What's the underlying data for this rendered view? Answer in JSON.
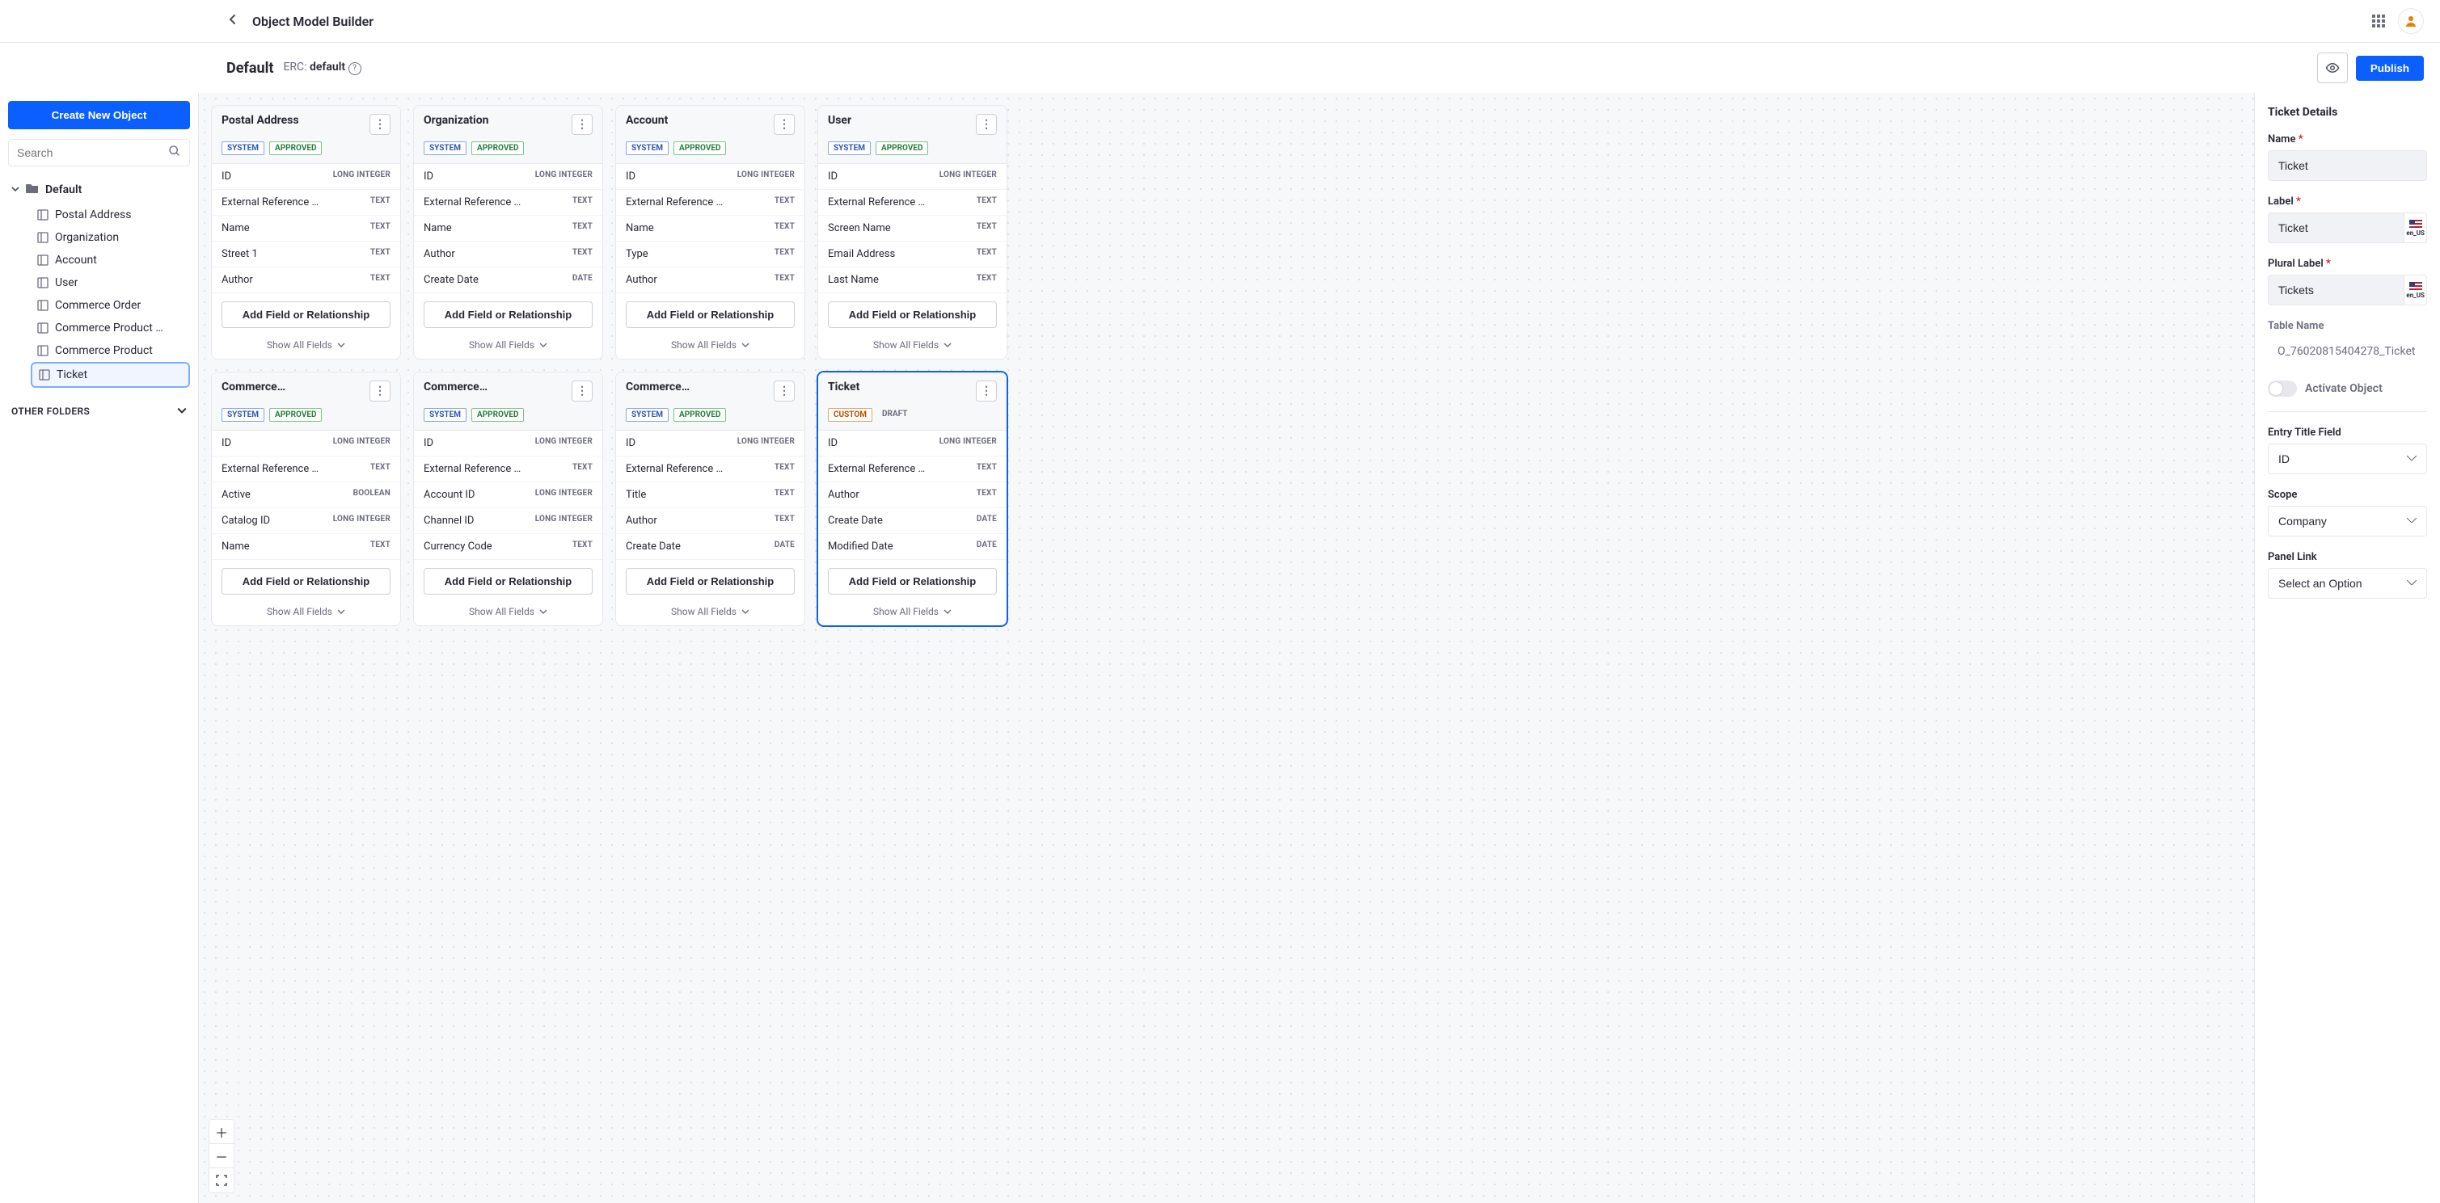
{
  "header": {
    "title": "Object Model Builder"
  },
  "subheader": {
    "default_label": "Default",
    "erc_label": "ERC:",
    "erc_value": "default",
    "publish_label": "Publish"
  },
  "sidebar": {
    "create_button": "Create New Object",
    "search_placeholder": "Search",
    "folder_label": "Default",
    "other_folders_label": "OTHER FOLDERS",
    "items": [
      {
        "label": "Postal Address",
        "selected": false
      },
      {
        "label": "Organization",
        "selected": false
      },
      {
        "label": "Account",
        "selected": false
      },
      {
        "label": "User",
        "selected": false
      },
      {
        "label": "Commerce Order",
        "selected": false
      },
      {
        "label": "Commerce Product …",
        "selected": false
      },
      {
        "label": "Commerce Product",
        "selected": false
      },
      {
        "label": "Ticket",
        "selected": true
      }
    ]
  },
  "canvas": {
    "add_field_label": "Add Field or Relationship",
    "show_all_label": "Show All Fields",
    "cards": [
      {
        "title": "Postal Address",
        "badges": [
          "SYSTEM",
          "APPROVED"
        ],
        "selected": false,
        "title_class": "",
        "fields": [
          {
            "name": "ID",
            "type": "LONG INTEGER"
          },
          {
            "name": "External Reference …",
            "type": "TEXT"
          },
          {
            "name": "Name",
            "type": "TEXT"
          },
          {
            "name": "Street 1",
            "type": "TEXT"
          },
          {
            "name": "Author",
            "type": "TEXT"
          }
        ]
      },
      {
        "title": "Organization",
        "badges": [
          "SYSTEM",
          "APPROVED"
        ],
        "selected": false,
        "title_class": "",
        "fields": [
          {
            "name": "ID",
            "type": "LONG INTEGER"
          },
          {
            "name": "External Reference …",
            "type": "TEXT"
          },
          {
            "name": "Name",
            "type": "TEXT"
          },
          {
            "name": "Author",
            "type": "TEXT"
          },
          {
            "name": "Create Date",
            "type": "DATE"
          }
        ]
      },
      {
        "title": "Account",
        "badges": [
          "SYSTEM",
          "APPROVED"
        ],
        "selected": false,
        "title_class": "",
        "fields": [
          {
            "name": "ID",
            "type": "LONG INTEGER"
          },
          {
            "name": "External Reference …",
            "type": "TEXT"
          },
          {
            "name": "Name",
            "type": "TEXT"
          },
          {
            "name": "Type",
            "type": "TEXT"
          },
          {
            "name": "Author",
            "type": "TEXT"
          }
        ]
      },
      {
        "title": "User",
        "badges": [
          "SYSTEM",
          "APPROVED"
        ],
        "selected": false,
        "title_class": "",
        "fields": [
          {
            "name": "ID",
            "type": "LONG INTEGER"
          },
          {
            "name": "External Reference …",
            "type": "TEXT"
          },
          {
            "name": "Screen Name",
            "type": "TEXT"
          },
          {
            "name": "Email Address",
            "type": "TEXT"
          },
          {
            "name": "Last Name",
            "type": "TEXT"
          }
        ]
      },
      {
        "title": "Commerce P…",
        "badges": [
          "SYSTEM",
          "APPROVED"
        ],
        "selected": false,
        "title_class": "ellip-narrow",
        "fields": [
          {
            "name": "ID",
            "type": "LONG INTEGER"
          },
          {
            "name": "External Reference …",
            "type": "TEXT"
          },
          {
            "name": "Active",
            "type": "BOOLEAN"
          },
          {
            "name": "Catalog ID",
            "type": "LONG INTEGER"
          },
          {
            "name": "Name",
            "type": "TEXT"
          }
        ]
      },
      {
        "title": "Commerce …",
        "badges": [
          "SYSTEM",
          "APPROVED"
        ],
        "selected": false,
        "title_class": "ellip-narrow",
        "fields": [
          {
            "name": "ID",
            "type": "LONG INTEGER"
          },
          {
            "name": "External Reference …",
            "type": "TEXT"
          },
          {
            "name": "Account ID",
            "type": "LONG INTEGER"
          },
          {
            "name": "Channel ID",
            "type": "LONG INTEGER"
          },
          {
            "name": "Currency Code",
            "type": "TEXT"
          }
        ]
      },
      {
        "title": "Commerce P…",
        "badges": [
          "SYSTEM",
          "APPROVED"
        ],
        "selected": false,
        "title_class": "ellip-narrow",
        "fields": [
          {
            "name": "ID",
            "type": "LONG INTEGER"
          },
          {
            "name": "External Reference …",
            "type": "TEXT"
          },
          {
            "name": "Title",
            "type": "TEXT"
          },
          {
            "name": "Author",
            "type": "TEXT"
          },
          {
            "name": "Create Date",
            "type": "DATE"
          }
        ]
      },
      {
        "title": "Ticket",
        "badges": [
          "CUSTOM",
          "DRAFT"
        ],
        "selected": true,
        "title_class": "",
        "fields": [
          {
            "name": "ID",
            "type": "LONG INTEGER"
          },
          {
            "name": "External Reference …",
            "type": "TEXT"
          },
          {
            "name": "Author",
            "type": "TEXT"
          },
          {
            "name": "Create Date",
            "type": "DATE"
          },
          {
            "name": "Modified Date",
            "type": "DATE"
          }
        ]
      }
    ]
  },
  "details": {
    "title": "Ticket Details",
    "name_label": "Name",
    "name_value": "Ticket",
    "label_label": "Label",
    "label_value": "Ticket",
    "plural_label": "Plural Label",
    "plural_value": "Tickets",
    "locale_code": "en_US",
    "table_name_label": "Table Name",
    "table_name_value": "O_76020815404278_Ticket",
    "activate_label": "Activate Object",
    "entry_title_label": "Entry Title Field",
    "entry_title_value": "ID",
    "scope_label": "Scope",
    "scope_value": "Company",
    "panel_link_label": "Panel Link",
    "panel_link_value": "Select an Option"
  }
}
